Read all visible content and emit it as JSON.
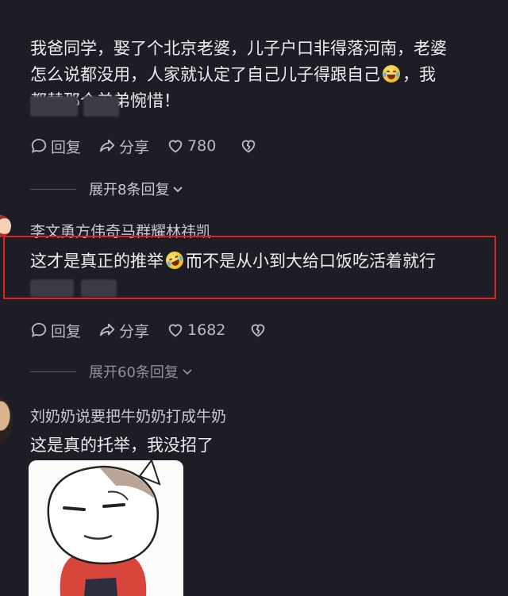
{
  "comment1": {
    "line1": "我爸同学，娶了个北京老婆，儿子户口非得落河南，老婆",
    "line2_before": "怎么说都没用，人家就认定了自己儿子得跟自己",
    "line2_after": "，我",
    "line3": "都替那个弟弟惋惜！",
    "emoji": "grinning-sweat-emoji",
    "actions": {
      "reply": "回复",
      "share": "分享",
      "likes": "780"
    },
    "expand": "展开8条回复"
  },
  "comment2": {
    "username": "李文勇方伟奇马群耀林祎凯",
    "text_before": "这才是真正的推举",
    "text_after": "而不是从小到大给口饭吃活着就行",
    "emoji": "rolling-laughing-emoji",
    "actions": {
      "reply": "回复",
      "share": "分享",
      "likes": "1682"
    },
    "expand": "展开60条回复"
  },
  "comment3": {
    "username": "刘奶奶说要把牛奶奶打成牛奶",
    "text": "这是真的托举，我没招了",
    "sticker": "cartoon-cat-sticker"
  },
  "colors": {
    "background": "#1d1e25",
    "highlight": "#e0231b",
    "muted": "#b9bac2"
  },
  "icons": [
    "comment-icon",
    "share-icon",
    "heart-icon",
    "broken-heart-icon",
    "chevron-down-icon"
  ]
}
